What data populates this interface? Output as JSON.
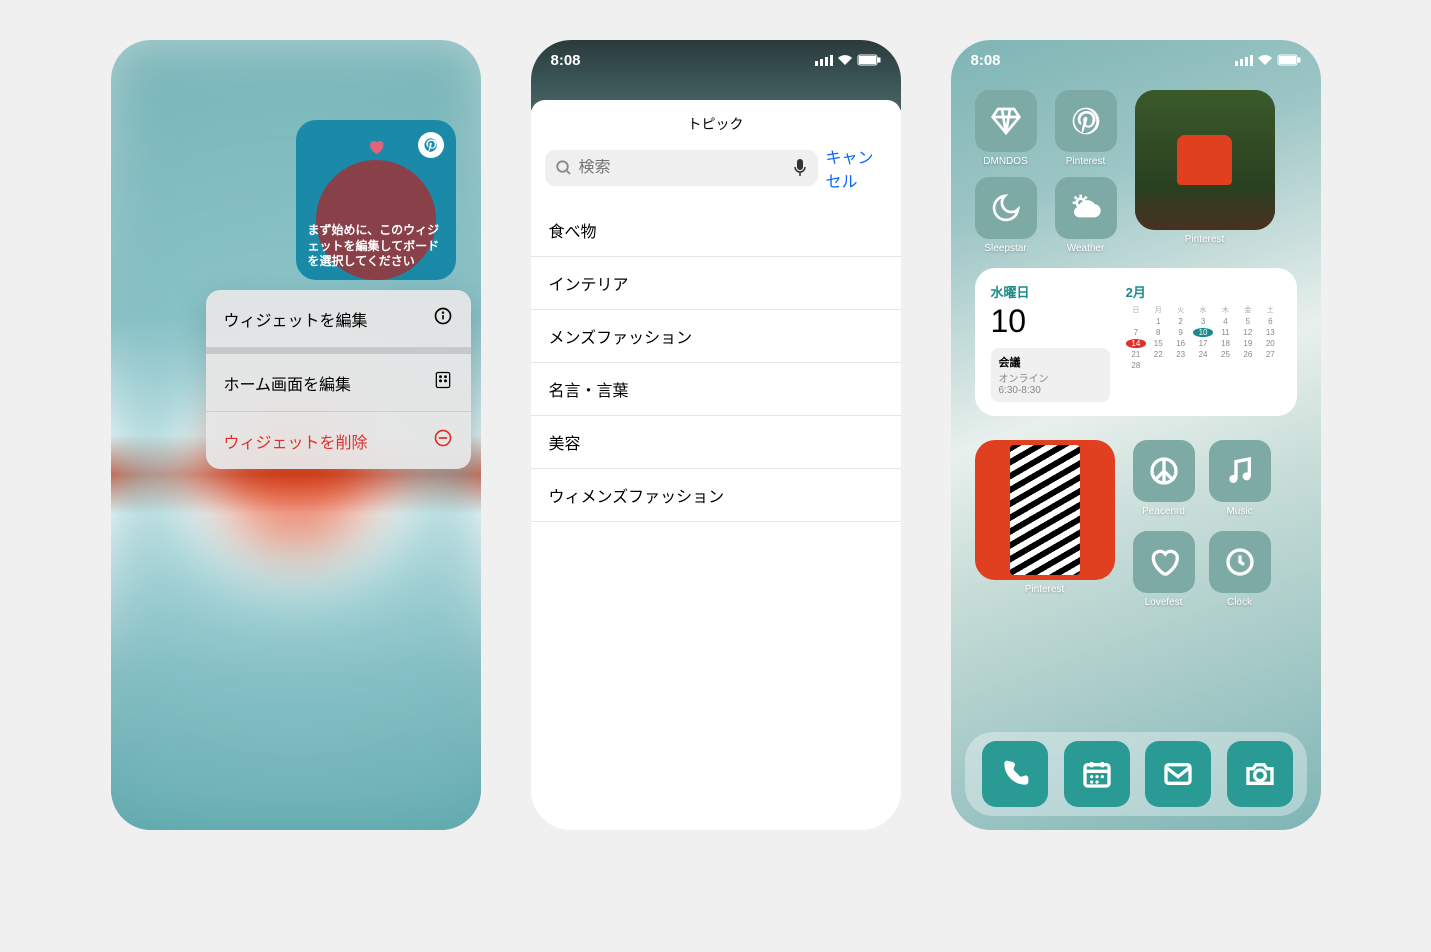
{
  "phone1": {
    "widget_text": "まず始めに、このウィジェットを編集してボードを選択してください",
    "menu": {
      "edit_widget": "ウィジェットを編集",
      "edit_home": "ホーム画面を編集",
      "delete_widget": "ウィジェットを削除"
    }
  },
  "phone2": {
    "time": "8:08",
    "title": "トピック",
    "search_placeholder": "検索",
    "cancel": "キャンセル",
    "topics": [
      "食べ物",
      "インテリア",
      "メンズファッション",
      "名言・言葉",
      "美容",
      "ウィメンズファッション"
    ]
  },
  "phone3": {
    "time": "8:08",
    "apps_row1": [
      {
        "label": "DMNDOS",
        "icon": "diamond"
      },
      {
        "label": "Pinterest",
        "icon": "pinterest"
      }
    ],
    "apps_row2": [
      {
        "label": "Sleepstar",
        "icon": "moon"
      },
      {
        "label": "Weather",
        "icon": "weather"
      }
    ],
    "widget_pinterest_label": "Pinterest",
    "calendar": {
      "day_label": "水曜日",
      "day_num": "10",
      "month": "2月",
      "event": {
        "title": "会議",
        "location": "オンライン",
        "time": "6:30-8:30"
      },
      "weekdays": [
        "日",
        "月",
        "火",
        "水",
        "木",
        "金",
        "土"
      ],
      "today": 10,
      "marked": 14,
      "days_in_month": 28,
      "start_offset": 1
    },
    "fashion_label": "Pinterest",
    "apps_side": [
      {
        "label": "Peacenrd",
        "icon": "peace"
      },
      {
        "label": "Music",
        "icon": "music"
      },
      {
        "label": "Lovefest",
        "icon": "heart"
      },
      {
        "label": "Clock",
        "icon": "clock"
      }
    ],
    "dock": [
      {
        "icon": "phone"
      },
      {
        "icon": "calendar"
      },
      {
        "icon": "mail"
      },
      {
        "icon": "camera"
      }
    ]
  }
}
